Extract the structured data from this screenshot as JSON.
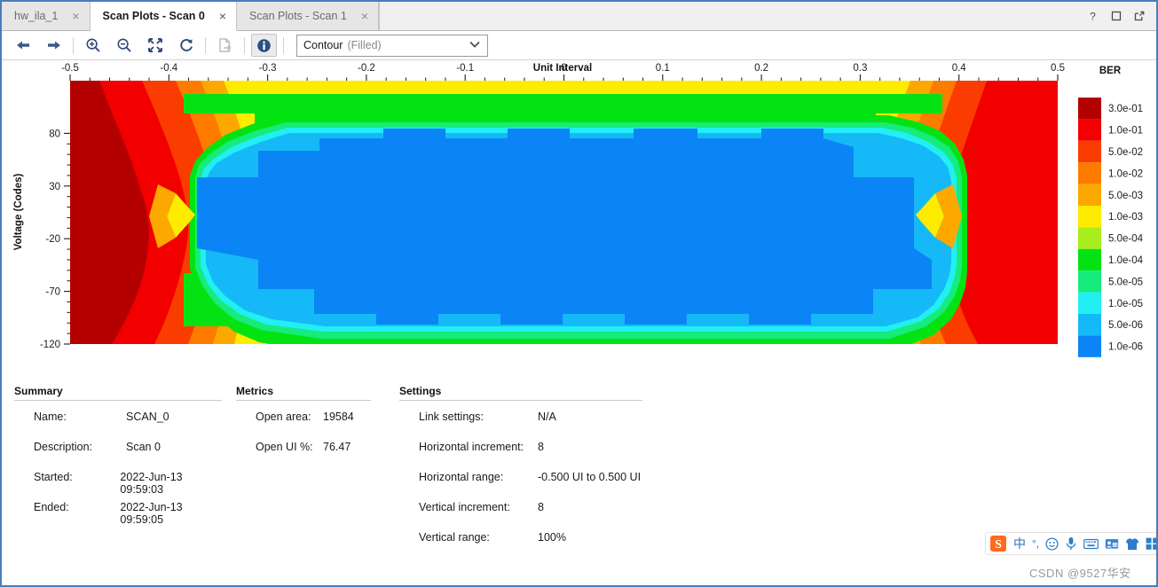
{
  "window": {
    "controls": [
      {
        "name": "help-button",
        "glyph": "?"
      },
      {
        "name": "maximize-button",
        "glyph": "□"
      },
      {
        "name": "float-button",
        "glyph": "↗"
      }
    ]
  },
  "tabs": [
    {
      "label": "hw_ila_1",
      "active": false,
      "close": "×"
    },
    {
      "label": "Scan Plots - Scan 0",
      "active": true,
      "close": "×"
    },
    {
      "label": "Scan Plots - Scan 1",
      "active": false,
      "close": "×"
    }
  ],
  "toolbar": {
    "buttons": [
      {
        "name": "back-button",
        "icon": "arrow-left-icon",
        "state": "enabled"
      },
      {
        "name": "forward-button",
        "icon": "arrow-right-icon",
        "state": "enabled"
      },
      {
        "name": "zoom-in-button",
        "icon": "zoom-in-icon",
        "state": "enabled"
      },
      {
        "name": "zoom-out-button",
        "icon": "zoom-out-icon",
        "state": "enabled"
      },
      {
        "name": "zoom-fit-button",
        "icon": "expand-icon",
        "state": "enabled"
      },
      {
        "name": "refresh-button",
        "icon": "refresh-icon",
        "state": "enabled"
      },
      {
        "name": "export-button",
        "icon": "export-icon",
        "state": "disabled"
      },
      {
        "name": "info-button",
        "icon": "info-icon",
        "state": "active"
      }
    ],
    "plot_type_select": {
      "value": "Contour",
      "qualifier": "(Filled)",
      "arrow": "∨"
    }
  },
  "chart_data": {
    "type": "heatmap",
    "title": "Unit Interval",
    "xlabel": "Unit Interval",
    "ylabel": "Voltage (Codes)",
    "legend_title": "BER",
    "legend_position": "right",
    "grid": false,
    "xlim": [
      -0.5,
      0.5
    ],
    "ylim": [
      -120,
      130
    ],
    "xticks": [
      -0.5,
      -0.4,
      -0.3,
      -0.2,
      -0.1,
      0,
      0.1,
      0.2,
      0.3,
      0.4,
      0.5
    ],
    "xticklabels": [
      "-0.5",
      "-0.4",
      "-0.3",
      "-0.2",
      "-0.1",
      "0",
      "0.1",
      "0.2",
      "0.3",
      "0.4",
      "0.5"
    ],
    "x_minor_per_major": 5,
    "yticks": [
      80,
      30,
      -20,
      -70,
      -120
    ],
    "yticklabels": [
      "80",
      "30",
      "-20",
      "-70",
      "-120"
    ],
    "legend_entries": [
      {
        "label": "3.0e-01",
        "color": "#b50000"
      },
      {
        "label": "1.0e-01",
        "color": "#f20000"
      },
      {
        "label": "5.0e-02",
        "color": "#fb3c00"
      },
      {
        "label": "1.0e-02",
        "color": "#fd7c00"
      },
      {
        "label": "5.0e-03",
        "color": "#fda800"
      },
      {
        "label": "1.0e-03",
        "color": "#feec00"
      },
      {
        "label": "5.0e-04",
        "color": "#a8ee1c"
      },
      {
        "label": "1.0e-04",
        "color": "#04e312"
      },
      {
        "label": "5.0e-05",
        "color": "#16eb7c"
      },
      {
        "label": "1.0e-05",
        "color": "#21eff4"
      },
      {
        "label": "5.0e-06",
        "color": "#16b9f7"
      },
      {
        "label": "1.0e-06",
        "color": "#0b85f5"
      }
    ]
  },
  "summary": {
    "heading": "Summary",
    "rows": [
      {
        "key": "Name:",
        "value": "SCAN_0"
      },
      {
        "key": "Description:",
        "value": "Scan 0"
      },
      {
        "key": "Started:",
        "value": "2022-Jun-13 09:59:03"
      },
      {
        "key": "Ended:",
        "value": "2022-Jun-13 09:59:05"
      }
    ]
  },
  "metrics": {
    "heading": "Metrics",
    "rows": [
      {
        "key": "Open area:",
        "value": "19584"
      },
      {
        "key": "Open UI %:",
        "value": "76.47"
      }
    ]
  },
  "settings": {
    "heading": "Settings",
    "rows": [
      {
        "key": "Link settings:",
        "value": "N/A"
      },
      {
        "key": "Horizontal increment:",
        "value": "8"
      },
      {
        "key": "Horizontal range:",
        "value": "-0.500 UI to 0.500 UI"
      },
      {
        "key": "Vertical increment:",
        "value": "8"
      },
      {
        "key": "Vertical range:",
        "value": "100%"
      }
    ]
  },
  "ime": {
    "items": [
      {
        "name": "sogou-logo-icon",
        "glyph": "S"
      },
      {
        "name": "chinese-mode-icon",
        "glyph": "中"
      },
      {
        "name": "punctuation-mode-icon",
        "glyph": "°,"
      },
      {
        "name": "emoji-icon",
        "glyph": "☺"
      },
      {
        "name": "voice-input-icon",
        "glyph": "↓"
      },
      {
        "name": "soft-keyboard-icon",
        "glyph": "⌨"
      },
      {
        "name": "input-card-icon",
        "glyph": "▤"
      },
      {
        "name": "skin-icon",
        "glyph": "T"
      },
      {
        "name": "toolbox-icon",
        "glyph": "░"
      }
    ]
  },
  "watermark": {
    "text": "CSDN @9527华安"
  }
}
